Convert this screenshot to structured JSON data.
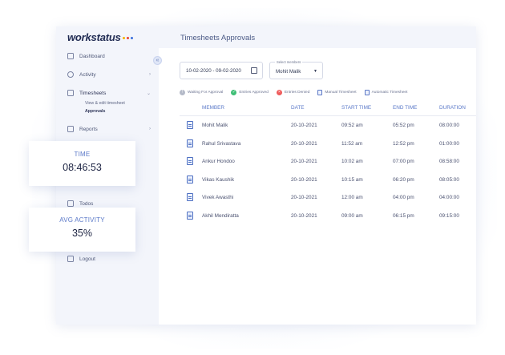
{
  "app": {
    "logo_text": "workstatus",
    "logo_dot_colors": [
      "#f4b400",
      "#e84335",
      "#3b6fdc"
    ],
    "page_title": "Timesheets Approvals"
  },
  "sidebar": {
    "collapse_icon": "double-chevron-left-icon",
    "items": [
      {
        "label": "Dashboard",
        "icon": "grid-icon",
        "chevron": ""
      },
      {
        "label": "Activity",
        "icon": "activity-icon",
        "chevron": "›"
      },
      {
        "label": "Timesheets",
        "icon": "timesheet-icon",
        "chevron": "⌄"
      },
      {
        "label": "Reports",
        "icon": "report-icon",
        "chevron": "›"
      },
      {
        "label": "Todos",
        "icon": "todo-icon",
        "chevron": ""
      },
      {
        "label": "Logout",
        "icon": "logout-icon",
        "chevron": ""
      }
    ],
    "sub_items": [
      "View & edit timesheet",
      "Approvals"
    ]
  },
  "filters": {
    "date_range": "10-02-2020 - 09-02-2020",
    "member_select_label": "Select members",
    "member_select_value": "Mohit Malik"
  },
  "legend": [
    {
      "label": "Waiting For Approval",
      "color": "#b4bac8",
      "symbol": "!"
    },
    {
      "label": "Entries Approved",
      "color": "#3fbf76",
      "symbol": "✓"
    },
    {
      "label": "Entries Denied",
      "color": "#ef5b5b",
      "symbol": "×"
    },
    {
      "label": "Manual Timesheet",
      "color": "#5b78c6",
      "symbol": "doc"
    },
    {
      "label": "Automatic Timesheet",
      "color": "#5b78c6",
      "symbol": "doc"
    }
  ],
  "table": {
    "columns": [
      "MEMBER",
      "DATE",
      "START TIME",
      "END TIME",
      "DURATION"
    ],
    "rows": [
      {
        "member": "Mohit Malik",
        "date": "20-10-2021",
        "start": "09:52 am",
        "end": "05:52 pm",
        "duration": "08:00:00"
      },
      {
        "member": "Rahul Srivastava",
        "date": "20-10-2021",
        "start": "11:52 am",
        "end": "12:52 pm",
        "duration": "01:00:00"
      },
      {
        "member": "Ankur Hondoo",
        "date": "20-10-2021",
        "start": "10:02 am",
        "end": "07:00 pm",
        "duration": "08:58:00"
      },
      {
        "member": "Vikas Kaushik",
        "date": "20-10-2021",
        "start": "10:15 am",
        "end": "06:20 pm",
        "duration": "08:05:00"
      },
      {
        "member": "Vivek Awasthi",
        "date": "20-10-2021",
        "start": "12:00 am",
        "end": "04:00 pm",
        "duration": "04:00:00"
      },
      {
        "member": "Akhil Mendiratta",
        "date": "20-10-2021",
        "start": "09:00 am",
        "end": "06:15 pm",
        "duration": "09:15:00"
      }
    ]
  },
  "cards": {
    "time_label": "TIME",
    "time_value": "08:46:53",
    "activity_label": "AVG ACTIVITY",
    "activity_value": "35%"
  }
}
